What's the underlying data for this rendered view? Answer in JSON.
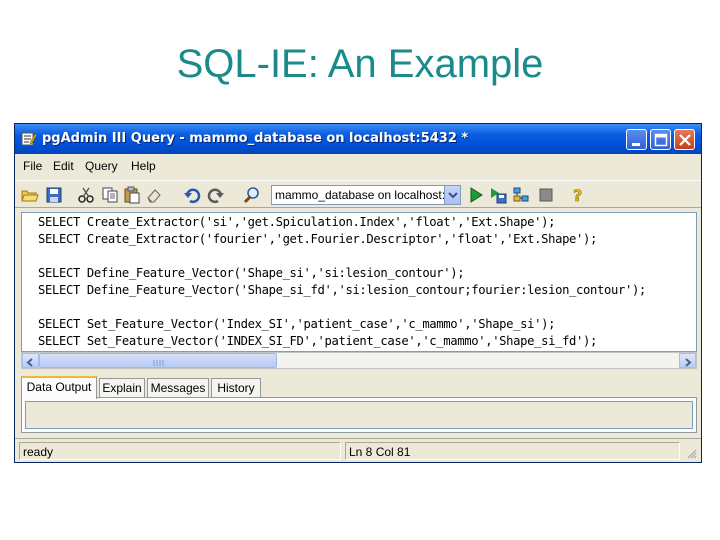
{
  "slide": {
    "title": "SQL-IE: An Example"
  },
  "window": {
    "title": "pgAdmin III Query - mammo_database on localhost:5432 *",
    "controls": [
      "minimize-icon",
      "maximize-icon",
      "close-icon"
    ]
  },
  "menu": [
    {
      "label": "File"
    },
    {
      "label": "Edit"
    },
    {
      "label": "Query"
    },
    {
      "label": "Help"
    }
  ],
  "toolbar": {
    "icons": [
      "open-icon",
      "save-icon",
      "cut-icon",
      "copy-icon",
      "paste-icon",
      "clear-icon",
      "undo-icon",
      "redo-icon",
      "find-icon"
    ],
    "database_select": "mammo_database on localhost:5432",
    "run_icons": [
      "execute-icon",
      "execute-to-file-icon",
      "explain-icon",
      "cancel-icon",
      "help-icon"
    ]
  },
  "editor": {
    "lines": [
      "SELECT Create_Extractor('si','get.Spiculation.Index','float','Ext.Shape');",
      "SELECT Create_Extractor('fourier','get.Fourier.Descriptor','float','Ext.Shape');",
      "",
      "SELECT Define_Feature_Vector('Shape_si','si:lesion_contour');",
      "SELECT Define_Feature_Vector('Shape_si_fd','si:lesion_contour;fourier:lesion_contour');",
      "",
      "SELECT Set_Feature_Vector('Index_SI','patient_case','c_mammo','Shape_si');",
      "SELECT Set_Feature_Vector('INDEX_SI_FD','patient_case','c_mammo','Shape_si_fd');"
    ]
  },
  "output_tabs": [
    {
      "label": "Data Output",
      "active": true
    },
    {
      "label": "Explain",
      "active": false
    },
    {
      "label": "Messages",
      "active": false
    },
    {
      "label": "History",
      "active": false
    }
  ],
  "status": {
    "state": "ready",
    "position": "Ln 8 Col 81"
  },
  "colors": {
    "title": "#1a8a8a",
    "titlebar": "#0a5ee0",
    "window_bg": "#ece9d8"
  }
}
